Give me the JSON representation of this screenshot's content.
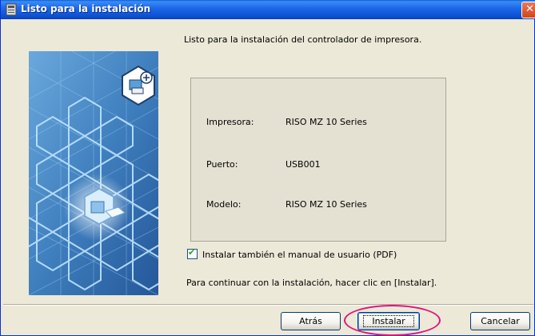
{
  "window": {
    "title": "Listo para la instalación",
    "close_glyph": "✕"
  },
  "main": {
    "heading": "Listo para la instalación del controlador de impresora.",
    "info": [
      {
        "label": "Impresora:",
        "value": "RISO MZ 10 Series"
      },
      {
        "label": "Puerto:",
        "value": "USB001"
      },
      {
        "label": "Modelo:",
        "value": "RISO MZ 10 Series"
      }
    ],
    "manual_checkbox": {
      "label": "Instalar también el manual de usuario (PDF)",
      "checked": true
    },
    "continue_text": "Para continuar con la instalación, hacer clic en [Instalar]."
  },
  "buttons": {
    "back": "Atrás",
    "install": "Instalar",
    "cancel": "Cancelar"
  },
  "colors": {
    "titlebar": "#0a4fd0",
    "highlight": "#e0147c",
    "art_background": "#3f7fbe"
  },
  "icons": {
    "title": "installer-icon",
    "art": "printer-add-icon"
  }
}
